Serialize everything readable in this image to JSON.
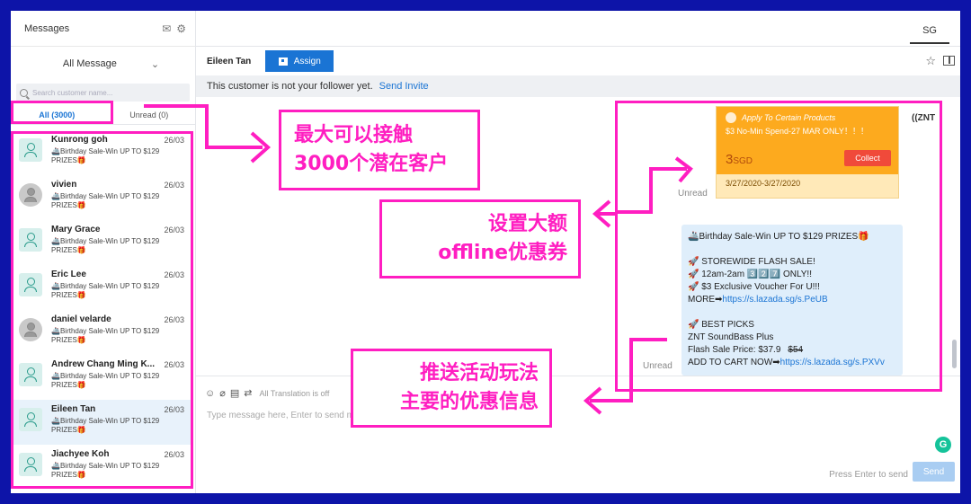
{
  "sidebar": {
    "title": "Messages",
    "filter_label": "All Message",
    "search_placeholder": "Search customer name...",
    "tabs": [
      {
        "label": "All (3000)",
        "active": true
      },
      {
        "label": "Unread (0)",
        "active": false
      }
    ],
    "items": [
      {
        "name": "Kunrong goh",
        "date": "26/03",
        "preview": "🚢Birthday Sale-Win UP TO $129 PRIZES🎁",
        "avatar": "default"
      },
      {
        "name": "vivien",
        "date": "26/03",
        "preview": "🚢Birthday Sale-Win UP TO $129 PRIZES🎁",
        "avatar": "photo"
      },
      {
        "name": "Mary Grace",
        "date": "26/03",
        "preview": "🚢Birthday Sale-Win UP TO $129 PRIZES🎁",
        "avatar": "default"
      },
      {
        "name": "Eric Lee",
        "date": "26/03",
        "preview": "🚢Birthday Sale-Win UP TO $129 PRIZES🎁",
        "avatar": "default"
      },
      {
        "name": "daniel velarde",
        "date": "26/03",
        "preview": "🚢Birthday Sale-Win UP TO $129 PRIZES🎁",
        "avatar": "photo"
      },
      {
        "name": "Andrew Chang Ming K...",
        "date": "26/03",
        "preview": "🚢Birthday Sale-Win UP TO $129 PRIZES🎁",
        "avatar": "default"
      },
      {
        "name": "Eileen Tan",
        "date": "26/03",
        "preview": "🚢Birthday Sale-Win UP TO $129 PRIZES🎁",
        "avatar": "default",
        "selected": true
      },
      {
        "name": "Jiachyee Koh",
        "date": "26/03",
        "preview": "🚢Birthday Sale-Win UP TO $129 PRIZES🎁",
        "avatar": "default"
      }
    ]
  },
  "topbar": {
    "region_tab": "SG"
  },
  "conversation": {
    "customer_name": "Eileen Tan",
    "assign_label": "Assign",
    "notice_text": "This customer is not your follower yet.",
    "notice_link": "Send Invite",
    "unread_label": "Unread",
    "shop_name": "ZNT",
    "voucher": {
      "applies": "Apply To Certain Products",
      "title": "$3 No-Min Spend-27 MAR ONLY！！！",
      "amount": "3",
      "currency": "SGD",
      "collect_label": "Collect",
      "validity": "3/27/2020-3/27/2020"
    },
    "message_lines": [
      "🚢Birthday Sale-Win UP TO $129 PRIZES🎁",
      "",
      "🚀 STOREWIDE FLASH SALE!",
      "🚀 12am-2am 3️⃣2️⃣7️⃣ ONLY!!",
      "🚀 $3 Exclusive Voucher For U!!!",
      {
        "text": "MORE➡",
        "link": "https://s.lazada.sg/s.PeUB"
      },
      "",
      "🚀 BEST PICKS",
      "ZNT SoundBass Plus",
      {
        "text": "Flash Sale Price: $37.9",
        "strike": "$54"
      },
      {
        "text": "ADD TO CART NOW➡",
        "link": "https://s.lazada.sg/s.PXVv"
      }
    ]
  },
  "composer": {
    "translation_label": "All Translation is off",
    "placeholder": "Type message here, Enter to send message",
    "press_enter_hint": "Press Enter to send",
    "send_label": "Send"
  },
  "annotations": [
    {
      "lines": [
        "最大可以接触",
        "3000个潜在客户"
      ]
    },
    {
      "lines": [
        "设置大额",
        "offline优惠券"
      ]
    },
    {
      "lines": [
        "推送活动玩法",
        "主要的优惠信息"
      ]
    }
  ],
  "colors": {
    "accent": "#1a74d4",
    "annotation": "#ff1ec1",
    "frame": "#0d14a8",
    "voucher": "#fdaa1e"
  }
}
